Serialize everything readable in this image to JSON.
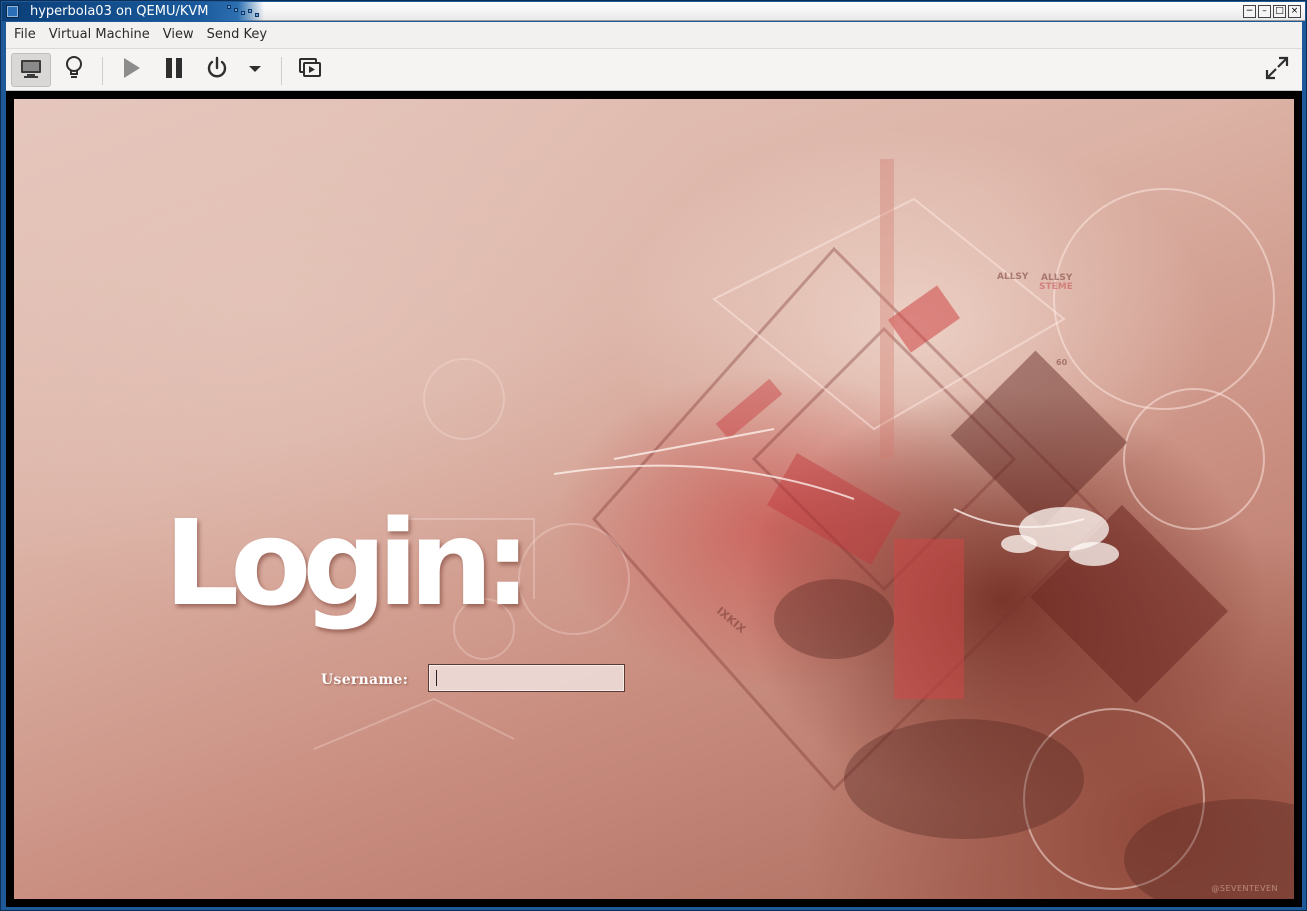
{
  "window": {
    "title": "hyperbola03 on QEMU/KVM",
    "wm_buttons": [
      {
        "name": "minimize-button",
        "glyph": "−"
      },
      {
        "name": "shade-button",
        "glyph": "–"
      },
      {
        "name": "maximize-button",
        "glyph": "□"
      },
      {
        "name": "close-button",
        "glyph": "×"
      }
    ]
  },
  "menubar": {
    "items": [
      "File",
      "Virtual Machine",
      "View",
      "Send Key"
    ]
  },
  "toolbar": {
    "buttons": [
      {
        "name": "console-view-button",
        "icon": "monitor-icon",
        "active": true
      },
      {
        "name": "details-view-button",
        "icon": "lightbulb-icon",
        "active": false
      },
      {
        "name": "run-button",
        "icon": "play-icon",
        "active": false
      },
      {
        "name": "pause-button",
        "icon": "pause-icon",
        "active": false
      },
      {
        "name": "shutdown-button",
        "icon": "power-icon",
        "active": false
      },
      {
        "name": "shutdown-menu-button",
        "icon": "chevron-down-icon",
        "active": false
      },
      {
        "name": "snapshots-button",
        "icon": "snapshots-icon",
        "active": false
      },
      {
        "name": "fullscreen-button",
        "icon": "fullscreen-icon",
        "active": false
      }
    ]
  },
  "guest": {
    "heading": "Login:",
    "username_label": "Username:",
    "username_value": "",
    "wallpaper_art_text": [
      "ALLSY",
      "ALLSY",
      "STEME",
      "60",
      "IXKIX"
    ],
    "watermark": "@SEVENTEVEN"
  },
  "colors": {
    "title_bar": "#1a5a9c",
    "app_background": "#f2f1f0",
    "display_border": "#000000",
    "wallpaper_base": "#dcb3a6",
    "wallpaper_accent": "#c0392b"
  }
}
